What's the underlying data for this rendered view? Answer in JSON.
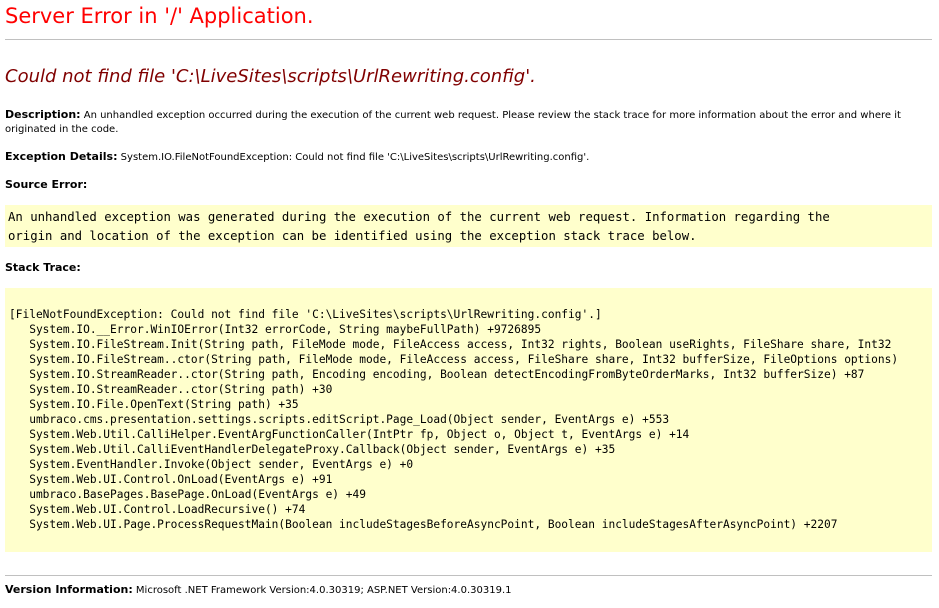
{
  "header": {
    "title": "Server Error in '/' Application."
  },
  "error": {
    "message": "Could not find file 'C:\\LiveSites\\scripts\\UrlRewriting.config'."
  },
  "description": {
    "label": "Description:",
    "text": "An unhandled exception occurred during the execution of the current web request. Please review the stack trace for more information about the error and where it originated in the code."
  },
  "exception_details": {
    "label": "Exception Details:",
    "text": "System.IO.FileNotFoundException: Could not find file 'C:\\LiveSites\\scripts\\UrlRewriting.config'."
  },
  "source_error": {
    "label": "Source Error:",
    "lines": [
      "An unhandled exception was generated during the execution of the current web request. Information regarding the",
      "origin and location of the exception can be identified using the exception stack trace below."
    ]
  },
  "stack_trace": {
    "label": "Stack Trace:",
    "lines": [
      "[FileNotFoundException: Could not find file 'C:\\LiveSites\\scripts\\UrlRewriting.config'.]",
      "   System.IO.__Error.WinIOError(Int32 errorCode, String maybeFullPath) +9726895",
      "   System.IO.FileStream.Init(String path, FileMode mode, FileAccess access, Int32 rights, Boolean useRights, FileShare share, Int32",
      "   System.IO.FileStream..ctor(String path, FileMode mode, FileAccess access, FileShare share, Int32 bufferSize, FileOptions options)",
      "   System.IO.StreamReader..ctor(String path, Encoding encoding, Boolean detectEncodingFromByteOrderMarks, Int32 bufferSize) +87",
      "   System.IO.StreamReader..ctor(String path) +30",
      "   System.IO.File.OpenText(String path) +35",
      "   umbraco.cms.presentation.settings.scripts.editScript.Page_Load(Object sender, EventArgs e) +553",
      "   System.Web.Util.CalliHelper.EventArgFunctionCaller(IntPtr fp, Object o, Object t, EventArgs e) +14",
      "   System.Web.Util.CalliEventHandlerDelegateProxy.Callback(Object sender, EventArgs e) +35",
      "   System.EventHandler.Invoke(Object sender, EventArgs e) +0",
      "   System.Web.UI.Control.OnLoad(EventArgs e) +91",
      "   umbraco.BasePages.BasePage.OnLoad(EventArgs e) +49",
      "   System.Web.UI.Control.LoadRecursive() +74",
      "   System.Web.UI.Page.ProcessRequestMain(Boolean includeStagesBeforeAsyncPoint, Boolean includeStagesAfterAsyncPoint) +2207"
    ]
  },
  "version": {
    "label": "Version Information:",
    "text": "Microsoft .NET Framework Version:4.0.30319; ASP.NET Version:4.0.30319.1"
  },
  "colors": {
    "title": "#ff0000",
    "error_message": "#800000",
    "code_background": "#ffffcc",
    "rule": "#c0c0c0"
  }
}
